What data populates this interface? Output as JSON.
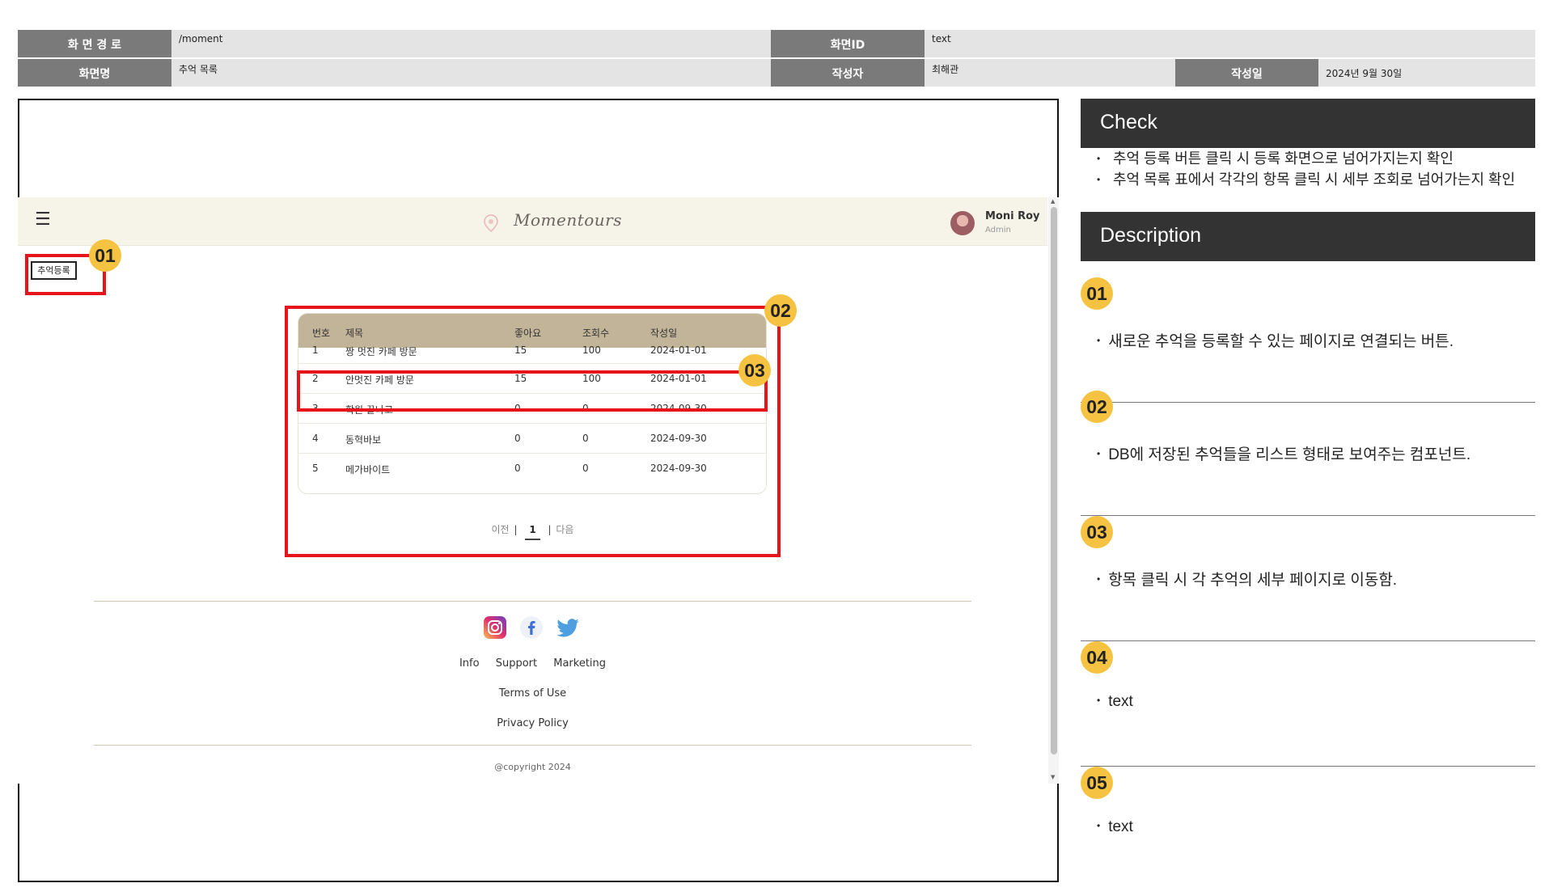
{
  "spec_header": {
    "path_label": "화 면 경 로",
    "path_value": "/moment",
    "screen_id_label": "화면ID",
    "screen_id_value": "text",
    "screen_name_label": "화면명",
    "screen_name_value": "추억 목록",
    "author_label": "작성자",
    "author_value": "최해관",
    "date_label": "작성일",
    "date_value": "2024년 9월 30일"
  },
  "app": {
    "menu_icon": "☰",
    "logo_text": "Momentours",
    "user_name": "Moni Roy",
    "user_role": "Admin",
    "add_button": "추억등록",
    "table": {
      "headers": [
        "번호",
        "제목",
        "좋아요",
        "조회수",
        "작성일"
      ],
      "rows": [
        {
          "no": "1",
          "title": "짱 멋진 카페 방문",
          "likes": "15",
          "views": "100",
          "date": "2024-01-01"
        },
        {
          "no": "2",
          "title": "안멋진 카페 방문",
          "likes": "15",
          "views": "100",
          "date": "2024-01-01"
        },
        {
          "no": "3",
          "title": "학원 끝나고",
          "likes": "0",
          "views": "0",
          "date": "2024-09-30"
        },
        {
          "no": "4",
          "title": "동혁바보",
          "likes": "0",
          "views": "0",
          "date": "2024-09-30"
        },
        {
          "no": "5",
          "title": "메가바이트",
          "likes": "0",
          "views": "0",
          "date": "2024-09-30"
        }
      ]
    },
    "pagination": {
      "prev": "이전",
      "current": "1",
      "next": "다음",
      "separator": "|"
    },
    "footer": {
      "social_icons": [
        "instagram-icon",
        "facebook-icon",
        "twitter-icon"
      ],
      "links": [
        "Info",
        "Support",
        "Marketing"
      ],
      "terms": "Terms of Use",
      "privacy": "Privacy Policy",
      "copyright": "@copyright 2024"
    }
  },
  "markers": {
    "m01": "01",
    "m02": "02",
    "m03": "03"
  },
  "panel": {
    "check_title": "Check",
    "check_items": [
      "추억 등록 버튼 클릭 시 등록 화면으로 넘어가지는지 확인",
      "추억 목록 표에서 각각의 항목 클릭 시 세부 조회로 넘어가는지 확인"
    ],
    "bullet": "•",
    "description_title": "Description",
    "descriptions": [
      {
        "num": "01",
        "text": "새로운 추억을 등록할 수 있는 페이지로 연결되는 버튼."
      },
      {
        "num": "02",
        "text": "DB에 저장된 추억들을 리스트 형태로 보여주는 컴포넌트."
      },
      {
        "num": "03",
        "text": "항목 클릭 시 각 추억의 세부 페이지로 이동함."
      },
      {
        "num": "04",
        "text": "text"
      },
      {
        "num": "05",
        "text": "text"
      }
    ]
  },
  "colors": {
    "header_label_bg": "#7a7a7a",
    "header_value_bg": "#e4e4e4",
    "app_header_bg": "#f6f3e9",
    "table_header_bg": "#c2b498",
    "annotation_red": "#e8141b",
    "marker_yellow": "#f5c242",
    "panel_bar_bg": "#333333"
  }
}
